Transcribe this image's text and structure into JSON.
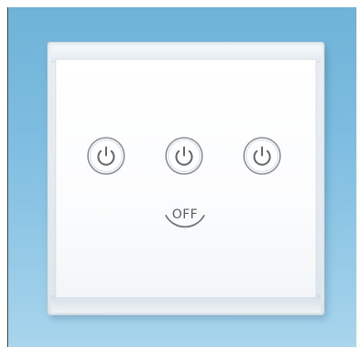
{
  "scene": {
    "subject": "touch-light-switch",
    "backdrop_color": "#7cbce0",
    "plate_color": "#ffffff",
    "button_stroke_color": "#6d7378"
  },
  "buttons": [
    {
      "icon": "power-icon"
    },
    {
      "icon": "power-icon"
    },
    {
      "icon": "power-icon"
    }
  ],
  "off_button": {
    "label": "OFF"
  }
}
